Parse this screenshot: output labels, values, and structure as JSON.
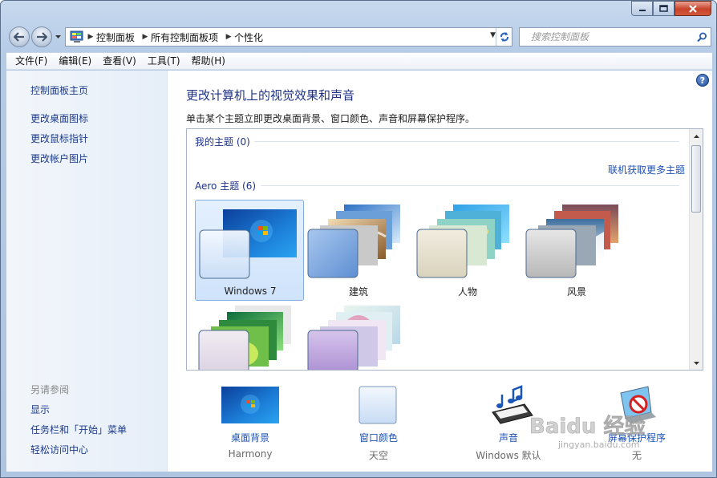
{
  "window": {
    "address_path": [
      "控制面板",
      "所有控制面板项",
      "个性化"
    ],
    "search_placeholder": "搜索控制面板"
  },
  "menubar": {
    "items": [
      "文件(F)",
      "编辑(E)",
      "查看(V)",
      "工具(T)",
      "帮助(H)"
    ]
  },
  "sidebar": {
    "home_link": "控制面板主页",
    "links": [
      "更改桌面图标",
      "更改鼠标指针",
      "更改帐户图片"
    ],
    "see_also_heading": "另请参阅",
    "see_also_links": [
      "显示",
      "任务栏和「开始」菜单",
      "轻松访问中心"
    ]
  },
  "main": {
    "title": "更改计算机上的视觉效果和声音",
    "description": "单击某个主题立即更改桌面背景、窗口颜色、声音和屏幕保护程序。",
    "my_themes_label": "我的主题 (0)",
    "more_themes_link": "联机获取更多主题",
    "aero_themes_label": "Aero 主题 (6)",
    "themes": [
      {
        "name": "Windows 7",
        "selected": true
      },
      {
        "name": "建筑",
        "selected": false
      },
      {
        "name": "人物",
        "selected": false
      },
      {
        "name": "风景",
        "selected": false
      },
      {
        "name": "",
        "selected": false
      },
      {
        "name": "",
        "selected": false
      }
    ],
    "bottom": [
      {
        "label": "桌面背景",
        "value": "Harmony"
      },
      {
        "label": "窗口颜色",
        "value": "天空"
      },
      {
        "label": "声音",
        "value": "Windows 默认"
      },
      {
        "label": "屏幕保护程序",
        "value": "无"
      }
    ]
  },
  "watermark": {
    "text": "Baidu 经验",
    "url": "jingyan.baidu.com"
  },
  "colors": {
    "link": "#1e52b5",
    "title": "#1e3287",
    "selection": "#cfe3fb"
  }
}
